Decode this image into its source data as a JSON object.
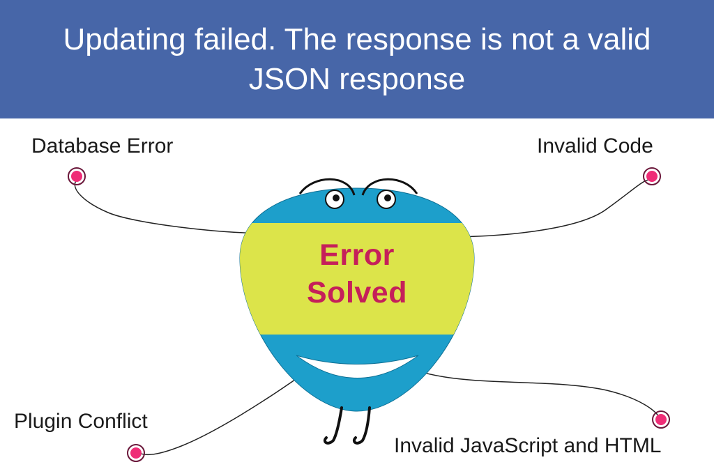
{
  "header": {
    "title": "Updating failed. The response is not a valid JSON response"
  },
  "mascot": {
    "belly_line1": "Error",
    "belly_line2": "Solved"
  },
  "labels": {
    "top_left": "Database Error",
    "top_right": "Invalid Code",
    "bottom_left": "Plugin Conflict",
    "bottom_right": "Invalid JavaScript and HTML"
  },
  "colors": {
    "header_bg": "#4766a8",
    "mascot_body": "#1d9fcb",
    "belly": "#dce44a",
    "dot_fill": "#ef2d77",
    "dot_stroke": "#6a173a",
    "text": "#1a1a1a"
  }
}
